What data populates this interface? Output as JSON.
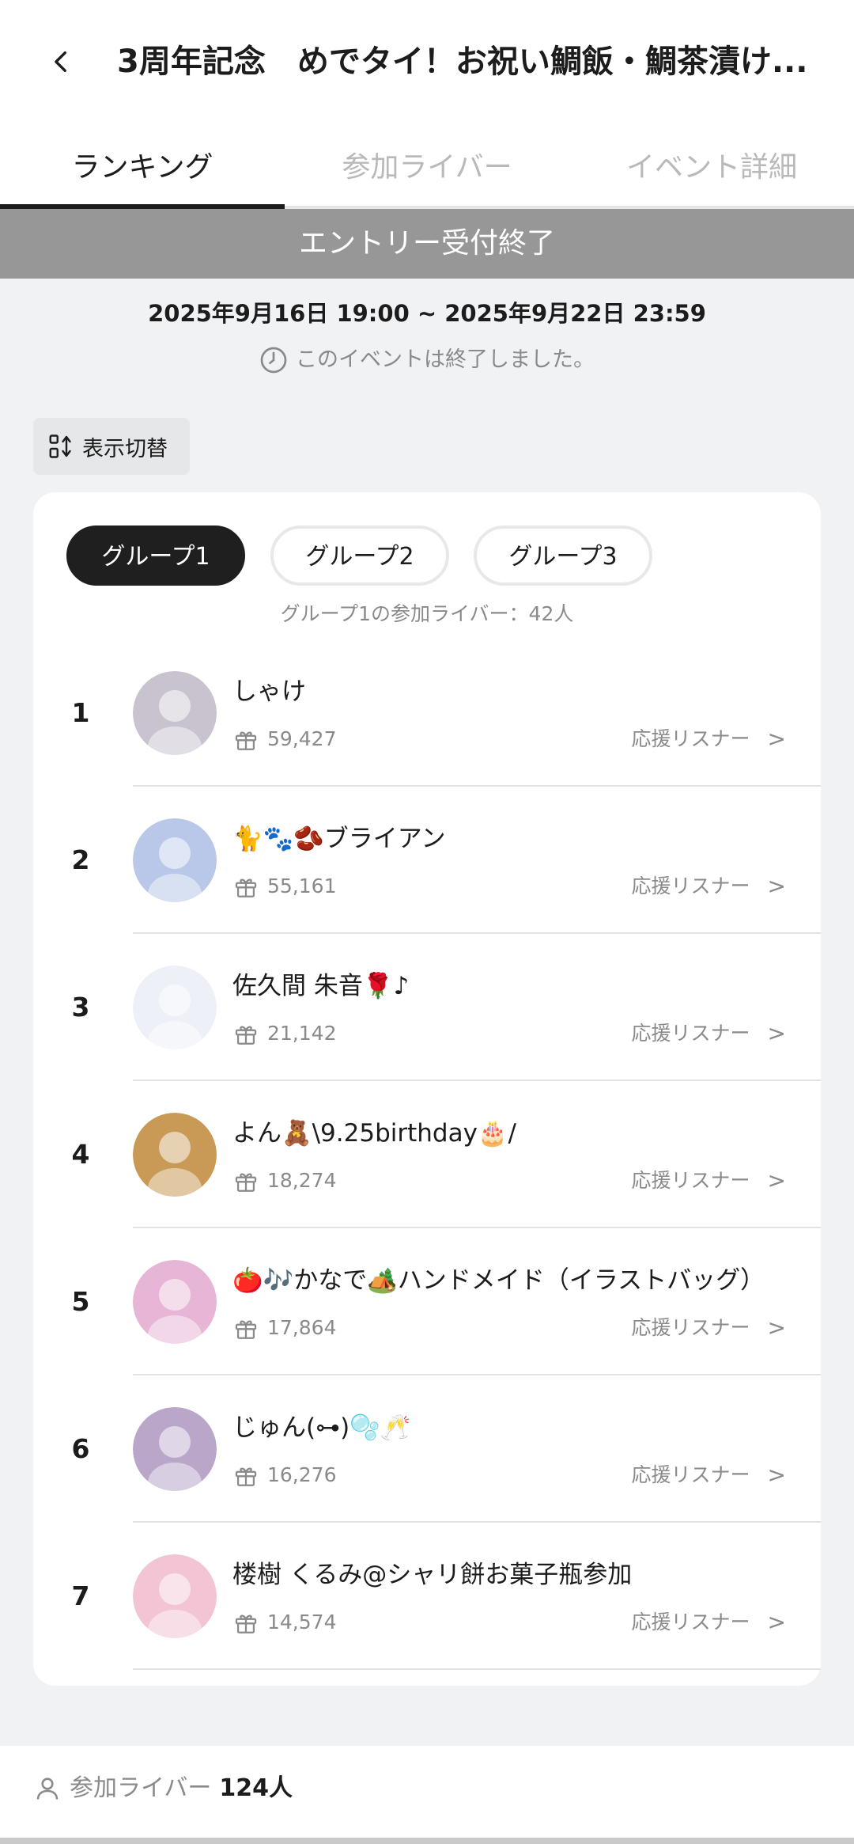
{
  "header": {
    "title": "3周年記念　めでタイ！お祝い鯛飯・鯛茶漬け..."
  },
  "tabs": [
    {
      "label": "ランキング",
      "active": true
    },
    {
      "label": "参加ライバー",
      "active": false
    },
    {
      "label": "イベント詳細",
      "active": false
    }
  ],
  "banner": {
    "text": "エントリー受付終了"
  },
  "event": {
    "period": "2025年9月16日 19:00 ~ 2025年9月22日 23:59",
    "status": "このイベントは終了しました。"
  },
  "view_toggle": {
    "label": "表示切替"
  },
  "groups": [
    {
      "label": "グループ1",
      "active": true
    },
    {
      "label": "グループ2",
      "active": false
    },
    {
      "label": "グループ3",
      "active": false
    }
  ],
  "group_count": "グループ1の参加ライバー：42人",
  "ranking": [
    {
      "rank": "1",
      "name": "しゃけ",
      "points": "59,427",
      "listener_label": "応援リスナー",
      "avatar_color": "#c9c3cf"
    },
    {
      "rank": "2",
      "name": "🐈🐾🫘ブライアン",
      "points": "55,161",
      "listener_label": "応援リスナー",
      "avatar_color": "#b9c8e8"
    },
    {
      "rank": "3",
      "name": "佐久間 朱音🌹♪",
      "points": "21,142",
      "listener_label": "応援リスナー",
      "avatar_color": "#eef0f8"
    },
    {
      "rank": "4",
      "name": "よん🧸\\9.25birthday🎂/",
      "points": "18,274",
      "listener_label": "応援リスナー",
      "avatar_color": "#c89a56"
    },
    {
      "rank": "5",
      "name": "🍅🎶かなで🏕️ハンドメイド（イラストバッグ）",
      "points": "17,864",
      "listener_label": "応援リスナー",
      "avatar_color": "#e7b6d6"
    },
    {
      "rank": "6",
      "name": "じゅん(⊶)🫧🥂",
      "points": "16,276",
      "listener_label": "応援リスナー",
      "avatar_color": "#b9a6c9"
    },
    {
      "rank": "7",
      "name": "楼樹 くるみ@シャリ餅お菓子瓶参加",
      "points": "14,574",
      "listener_label": "応援リスナー",
      "avatar_color": "#f2c4d4"
    }
  ],
  "footer": {
    "label": "参加ライバー",
    "count": "124人"
  },
  "colors": {
    "banner": "#979797",
    "active_tab": "#1c1c1c",
    "muted": "#8a8a8a"
  }
}
